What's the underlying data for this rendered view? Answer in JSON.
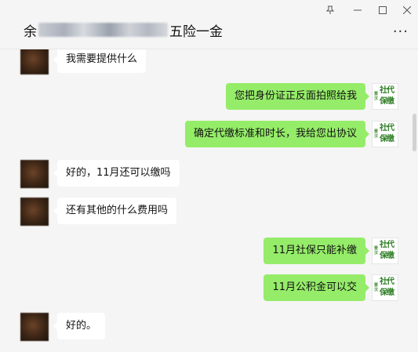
{
  "header": {
    "title_prefix": "余",
    "title_suffix": "五险一金",
    "pin_icon": "pin-icon",
    "more_label": "···",
    "window_controls": {
      "minimize": "minimize-icon",
      "maximize": "maximize-icon",
      "close": "close-icon"
    }
  },
  "contact_avatar": {
    "small_text": "壹汉",
    "big_text": "社代保缴",
    "color": "#2e7d23"
  },
  "messages": [
    {
      "side": "in",
      "text": "我需要提供什么"
    },
    {
      "side": "out",
      "text": "您把身份证正反面拍照给我"
    },
    {
      "side": "out",
      "text": "确定代缴标准和时长，我给您出协议"
    },
    {
      "side": "in",
      "text": "好的，11月还可以缴吗"
    },
    {
      "side": "in",
      "text": "还有其他的什么费用吗"
    },
    {
      "side": "out",
      "text": "11月社保只能补缴"
    },
    {
      "side": "out",
      "text": "11月公积金可以交"
    },
    {
      "side": "in",
      "text": "好的。"
    }
  ],
  "colors": {
    "background": "#f5f5f5",
    "incoming_bubble": "#ffffff",
    "outgoing_bubble": "#95ec69"
  }
}
